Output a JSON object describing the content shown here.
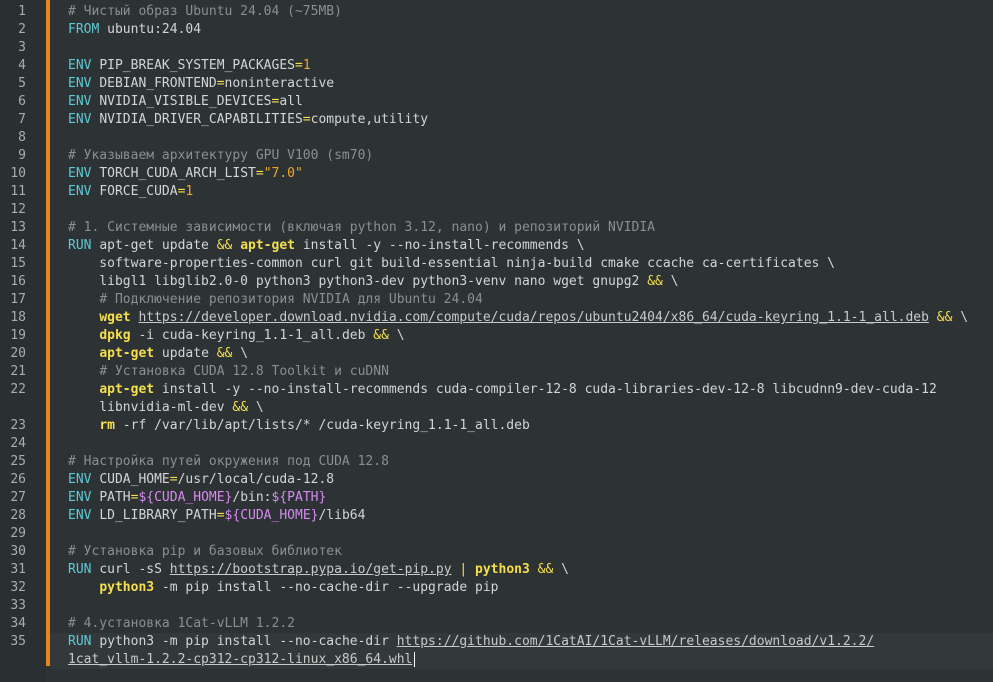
{
  "editor": {
    "lines": [
      {
        "n": "1",
        "tokens": [
          {
            "t": "# Чистый образ Ubuntu 24.04 (~75MB)",
            "c": "cm"
          }
        ]
      },
      {
        "n": "2",
        "tokens": [
          {
            "t": "FROM ",
            "c": "kw"
          },
          {
            "t": "ubuntu:24.04",
            "c": "txt"
          }
        ]
      },
      {
        "n": "3",
        "tokens": []
      },
      {
        "n": "4",
        "tokens": [
          {
            "t": "ENV ",
            "c": "kw"
          },
          {
            "t": "PIP_BREAK_SYSTEM_PACKAGES",
            "c": "txt"
          },
          {
            "t": "=",
            "c": "op"
          },
          {
            "t": "1",
            "c": "num"
          }
        ]
      },
      {
        "n": "5",
        "tokens": [
          {
            "t": "ENV ",
            "c": "kw"
          },
          {
            "t": "DEBIAN_FRONTEND",
            "c": "txt"
          },
          {
            "t": "=",
            "c": "op"
          },
          {
            "t": "noninteractive",
            "c": "txt"
          }
        ]
      },
      {
        "n": "6",
        "tokens": [
          {
            "t": "ENV ",
            "c": "kw"
          },
          {
            "t": "NVIDIA_VISIBLE_DEVICES",
            "c": "txt"
          },
          {
            "t": "=",
            "c": "op"
          },
          {
            "t": "all",
            "c": "txt"
          }
        ]
      },
      {
        "n": "7",
        "tokens": [
          {
            "t": "ENV ",
            "c": "kw"
          },
          {
            "t": "NVIDIA_DRIVER_CAPABILITIES",
            "c": "txt"
          },
          {
            "t": "=",
            "c": "op"
          },
          {
            "t": "compute,utility",
            "c": "txt"
          }
        ]
      },
      {
        "n": "8",
        "tokens": []
      },
      {
        "n": "9",
        "tokens": [
          {
            "t": "# Указываем архитектуру GPU V100 (sm70)",
            "c": "cm"
          }
        ]
      },
      {
        "n": "10",
        "tokens": [
          {
            "t": "ENV ",
            "c": "kw"
          },
          {
            "t": "TORCH_CUDA_ARCH_LIST",
            "c": "txt"
          },
          {
            "t": "=",
            "c": "op"
          },
          {
            "t": "\"7.0\"",
            "c": "str"
          }
        ]
      },
      {
        "n": "11",
        "tokens": [
          {
            "t": "ENV ",
            "c": "kw"
          },
          {
            "t": "FORCE_CUDA",
            "c": "txt"
          },
          {
            "t": "=",
            "c": "op"
          },
          {
            "t": "1",
            "c": "num"
          }
        ]
      },
      {
        "n": "12",
        "tokens": []
      },
      {
        "n": "13",
        "tokens": [
          {
            "t": "# 1. Системные зависимости (включая python 3.12, nano) и репозиторий NVIDIA",
            "c": "cm"
          }
        ]
      },
      {
        "n": "14",
        "tokens": [
          {
            "t": "RUN ",
            "c": "kw"
          },
          {
            "t": "apt-get update ",
            "c": "txt"
          },
          {
            "t": "&&",
            "c": "op"
          },
          {
            "t": " ",
            "c": "txt"
          },
          {
            "t": "apt-get",
            "c": "bi"
          },
          {
            "t": " install -y --no-install-recommends \\",
            "c": "txt"
          }
        ]
      },
      {
        "n": "15",
        "tokens": [
          {
            "t": "    software-properties-common curl git build-essential ninja-build cmake ccache ca-certificates \\",
            "c": "txt"
          }
        ]
      },
      {
        "n": "16",
        "tokens": [
          {
            "t": "    libgl1 libglib2.0-0 python3 python3-dev python3-venv nano wget gnupg2 ",
            "c": "txt"
          },
          {
            "t": "&&",
            "c": "op"
          },
          {
            "t": " \\",
            "c": "txt"
          }
        ]
      },
      {
        "n": "17",
        "tokens": [
          {
            "t": "    ",
            "c": "txt"
          },
          {
            "t": "# Подключение репозитория NVIDIA для Ubuntu 24.04",
            "c": "cm"
          }
        ]
      },
      {
        "n": "18",
        "tokens": [
          {
            "t": "    ",
            "c": "txt"
          },
          {
            "t": "wget",
            "c": "bi"
          },
          {
            "t": " ",
            "c": "txt"
          },
          {
            "t": "https://developer.download.nvidia.com/compute/cuda/repos/ubuntu2404/x86_64/cuda-keyring_1.1-1_all.deb",
            "c": "url"
          },
          {
            "t": " ",
            "c": "txt"
          },
          {
            "t": "&&",
            "c": "op"
          },
          {
            "t": " \\",
            "c": "txt"
          }
        ]
      },
      {
        "n": "19",
        "tokens": [
          {
            "t": "    ",
            "c": "txt"
          },
          {
            "t": "dpkg",
            "c": "bi"
          },
          {
            "t": " -i cuda-keyring_1.1-1_all.deb ",
            "c": "txt"
          },
          {
            "t": "&&",
            "c": "op"
          },
          {
            "t": " \\",
            "c": "txt"
          }
        ]
      },
      {
        "n": "20",
        "tokens": [
          {
            "t": "    ",
            "c": "txt"
          },
          {
            "t": "apt-get",
            "c": "bi"
          },
          {
            "t": " update ",
            "c": "txt"
          },
          {
            "t": "&&",
            "c": "op"
          },
          {
            "t": " \\",
            "c": "txt"
          }
        ]
      },
      {
        "n": "21",
        "tokens": [
          {
            "t": "    ",
            "c": "txt"
          },
          {
            "t": "# Установка CUDA 12.8 Toolkit и cuDNN",
            "c": "cm"
          }
        ]
      },
      {
        "n": "22",
        "tokens": [
          {
            "t": "    ",
            "c": "txt"
          },
          {
            "t": "apt-get",
            "c": "bi"
          },
          {
            "t": " install -y --no-install-recommends cuda-compiler-12-8 cuda-libraries-dev-12-8 libcudnn9-dev-cuda-12",
            "c": "txt"
          }
        ]
      },
      {
        "n": "",
        "tokens": [
          {
            "t": "    libnvidia-ml-dev ",
            "c": "txt"
          },
          {
            "t": "&&",
            "c": "op"
          },
          {
            "t": " \\",
            "c": "txt"
          }
        ]
      },
      {
        "n": "23",
        "tokens": [
          {
            "t": "    ",
            "c": "txt"
          },
          {
            "t": "rm",
            "c": "bi"
          },
          {
            "t": " -rf /var/lib/apt/lists/* /cuda-keyring_1.1-1_all.deb",
            "c": "txt"
          }
        ]
      },
      {
        "n": "24",
        "tokens": []
      },
      {
        "n": "25",
        "tokens": [
          {
            "t": "# Настройка путей окружения под CUDA 12.8",
            "c": "cm"
          }
        ]
      },
      {
        "n": "26",
        "tokens": [
          {
            "t": "ENV ",
            "c": "kw"
          },
          {
            "t": "CUDA_HOME",
            "c": "txt"
          },
          {
            "t": "=",
            "c": "op"
          },
          {
            "t": "/usr/local/cuda-12.8",
            "c": "txt"
          }
        ]
      },
      {
        "n": "27",
        "tokens": [
          {
            "t": "ENV ",
            "c": "kw"
          },
          {
            "t": "PATH",
            "c": "txt"
          },
          {
            "t": "=",
            "c": "op"
          },
          {
            "t": "${CUDA_HOME}",
            "c": "var"
          },
          {
            "t": "/bin:",
            "c": "txt"
          },
          {
            "t": "${PATH}",
            "c": "var"
          }
        ]
      },
      {
        "n": "28",
        "tokens": [
          {
            "t": "ENV ",
            "c": "kw"
          },
          {
            "t": "LD_LIBRARY_PATH",
            "c": "txt"
          },
          {
            "t": "=",
            "c": "op"
          },
          {
            "t": "${CUDA_HOME}",
            "c": "var"
          },
          {
            "t": "/lib64",
            "c": "txt"
          }
        ]
      },
      {
        "n": "29",
        "tokens": []
      },
      {
        "n": "30",
        "tokens": [
          {
            "t": "# Установка pip и базовых библиотек",
            "c": "cm"
          }
        ]
      },
      {
        "n": "31",
        "tokens": [
          {
            "t": "RUN ",
            "c": "kw"
          },
          {
            "t": "curl -sS ",
            "c": "txt"
          },
          {
            "t": "https://bootstrap.pypa.io/get-pip.py",
            "c": "url"
          },
          {
            "t": " ",
            "c": "txt"
          },
          {
            "t": "|",
            "c": "op"
          },
          {
            "t": " ",
            "c": "txt"
          },
          {
            "t": "python3",
            "c": "bi"
          },
          {
            "t": " ",
            "c": "txt"
          },
          {
            "t": "&&",
            "c": "op"
          },
          {
            "t": " \\",
            "c": "txt"
          }
        ]
      },
      {
        "n": "32",
        "tokens": [
          {
            "t": "    ",
            "c": "txt"
          },
          {
            "t": "python3",
            "c": "bi"
          },
          {
            "t": " -m pip install --no-cache-dir --upgrade pip",
            "c": "txt"
          }
        ]
      },
      {
        "n": "33",
        "tokens": []
      },
      {
        "n": "34",
        "tokens": [
          {
            "t": "# 4.установка 1Cat-vLLM 1.2.2",
            "c": "cm"
          }
        ]
      },
      {
        "n": "35",
        "cur": true,
        "tokens": [
          {
            "t": "RUN ",
            "c": "kw"
          },
          {
            "t": "python3 -m pip install --no-cache-dir ",
            "c": "txt"
          },
          {
            "t": "https://github.com/1CatAI/1Cat-vLLM/releases/download/v1.2.2/",
            "c": "url"
          }
        ]
      },
      {
        "n": "",
        "cur": true,
        "caret": true,
        "tokens": [
          {
            "t": "1cat_vllm-1.2.2-cp312-cp312-linux_x86_64.whl",
            "c": "url"
          }
        ]
      }
    ]
  }
}
